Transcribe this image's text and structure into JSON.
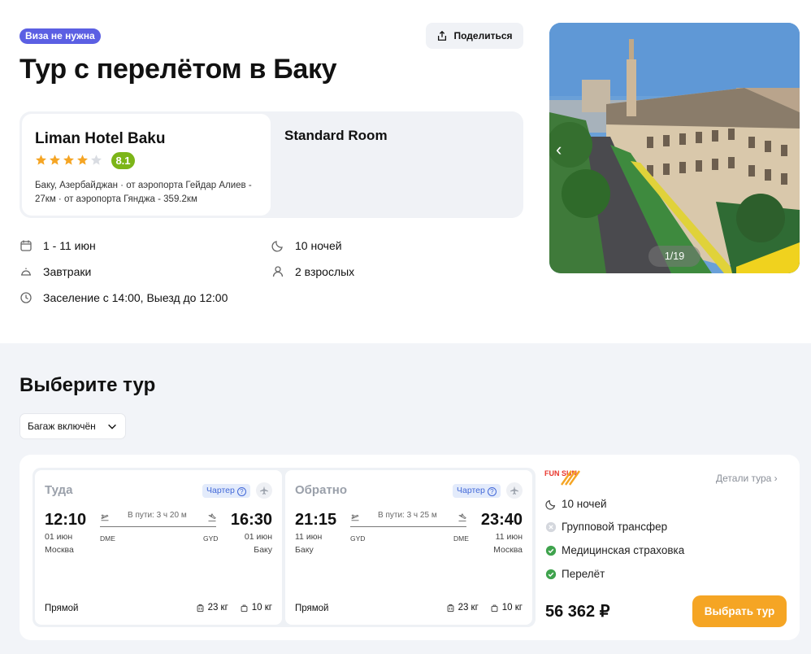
{
  "header": {
    "visa_badge": "Виза не нужна",
    "share_label": "Поделиться",
    "title": "Тур с перелётом в Баку"
  },
  "hotel": {
    "name": "Liman Hotel Baku",
    "stars": 4,
    "stars_max": 5,
    "rating": "8.1",
    "location": "Баку, Азербайджан · от аэропорта Гейдар Алиев - 27км · от аэропорта Гянджа - 359.2км",
    "room": "Standard Room"
  },
  "trip_info": {
    "dates": "1 - 11 июн",
    "nights": "10 ночей",
    "meals": "Завтраки",
    "guests": "2 взрослых",
    "checkin": "Заселение с 14:00, Выезд до 12:00"
  },
  "gallery": {
    "counter": "1/19",
    "prev": "‹"
  },
  "tours": {
    "title": "Выберите тур",
    "baggage_filter": "Багаж включён"
  },
  "tour_card": {
    "legs": [
      {
        "direction": "Туда",
        "charter": "Чартер",
        "charter_q": "?",
        "dep_time": "12:10",
        "arr_time": "16:30",
        "dep_date": "01 июн",
        "arr_date": "01 июн",
        "dep_city": "Москва",
        "arr_city": "Баку",
        "from_code": "DME",
        "to_code": "GYD",
        "duration": "В пути: 3 ч 20 м",
        "type": "Прямой",
        "luggage": "23 кг",
        "hand_luggage": "10 кг"
      },
      {
        "direction": "Обратно",
        "charter": "Чартер",
        "charter_q": "?",
        "dep_time": "21:15",
        "arr_time": "23:40",
        "dep_date": "11 июн",
        "arr_date": "11 июн",
        "dep_city": "Баку",
        "arr_city": "Москва",
        "from_code": "GYD",
        "to_code": "DME",
        "duration": "В пути: 3 ч 25 м",
        "type": "Прямой",
        "luggage": "23 кг",
        "hand_luggage": "10 кг"
      }
    ],
    "operator_logo_text": "FUN SUN",
    "details_link": "Детали тура",
    "features": [
      {
        "icon": "moon-icon",
        "text": "10 ночей",
        "included": true
      },
      {
        "icon": "cross-circle-icon",
        "text": "Групповой трансфер",
        "included": false
      },
      {
        "icon": "check-circle-icon",
        "text": "Медицинская страховка",
        "included": true
      },
      {
        "icon": "check-circle-icon",
        "text": "Перелёт",
        "included": true
      }
    ],
    "price": "56 362 ₽",
    "choose_button": "Выбрать тур"
  },
  "colors": {
    "visa_badge": "#5b5fe3",
    "rating": "#7cb518",
    "star": "#f5a524",
    "cta": "#f5a524",
    "charter_text": "#4268d8",
    "included": "#3fa34d",
    "section_bg": "#f2f4f8"
  }
}
